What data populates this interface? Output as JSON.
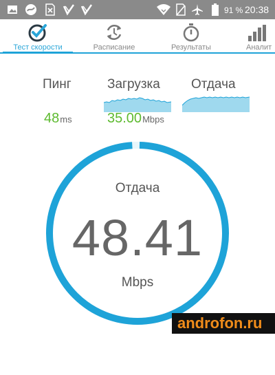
{
  "status_bar": {
    "battery_percent": "91 %",
    "time": "20:38",
    "icons": [
      "image-icon",
      "vpn-icon",
      "sim-x-icon",
      "check-notification-icon",
      "check-notification-icon",
      "wifi-icon",
      "no-sim-icon",
      "airplane-icon",
      "battery-icon"
    ]
  },
  "tabs": [
    {
      "label": "Тест скорости",
      "icon": "speed-check-icon",
      "active": true
    },
    {
      "label": "Расписание",
      "icon": "schedule-icon",
      "active": false
    },
    {
      "label": "Результаты",
      "icon": "stopwatch-icon",
      "active": false
    },
    {
      "label": "Аналит",
      "icon": "bar-chart-icon",
      "active": false
    }
  ],
  "metrics": {
    "ping": {
      "label": "Пинг",
      "value": "48",
      "unit": "ms"
    },
    "download": {
      "label": "Загрузка",
      "value": "35.00",
      "unit": "Mbps"
    },
    "upload": {
      "label": "Отдача"
    }
  },
  "gauge": {
    "label": "Отдача",
    "value": "48.41",
    "unit": "Mbps",
    "progress": 0.99
  },
  "watermark": "androfon.ru",
  "colors": {
    "accent": "#1ea3d8",
    "value_green": "#5dba2f",
    "spark_fill": "#9fd9ee",
    "status_bar": "#8a8a8a"
  }
}
